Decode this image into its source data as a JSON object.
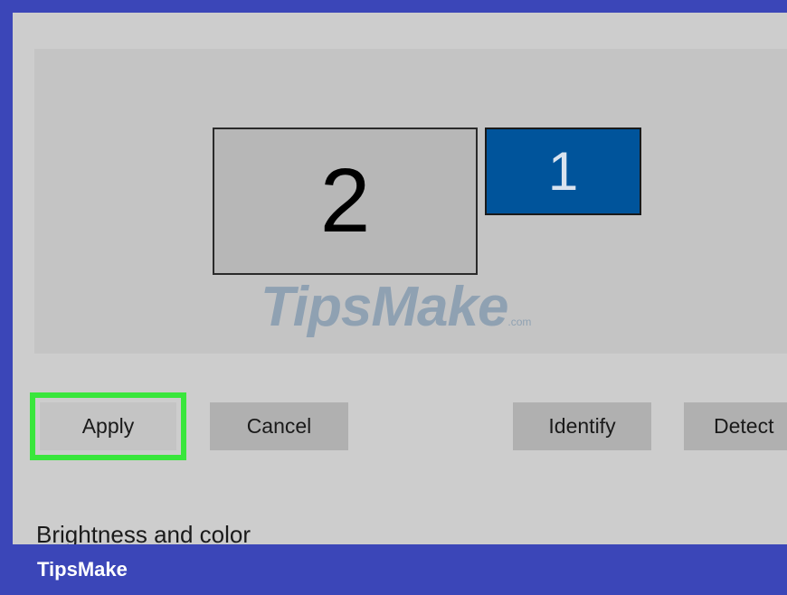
{
  "display_settings": {
    "monitors": [
      {
        "id": "monitor-2",
        "label": "2",
        "selected": false
      },
      {
        "id": "monitor-1",
        "label": "1",
        "selected": true
      }
    ],
    "buttons": {
      "apply": "Apply",
      "cancel": "Cancel",
      "identify": "Identify",
      "detect": "Detect"
    },
    "section_heading": "Brightness and color"
  },
  "watermark": {
    "text": "TipsMake",
    "suffix": ".com"
  },
  "footer": {
    "brand": "TipsMake"
  },
  "colors": {
    "frame": "#3b46b8",
    "panel_bg": "#cdcdcd",
    "selected_monitor": "#00549b",
    "apply_highlight": "#39e63c"
  }
}
